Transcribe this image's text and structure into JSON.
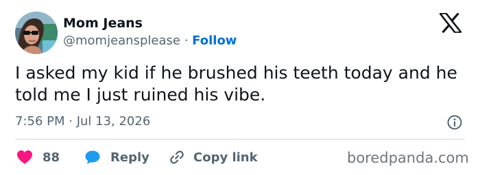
{
  "author": {
    "display_name": "Mom Jeans",
    "handle": "@momjeansplease",
    "separator": "·",
    "follow_label": "Follow"
  },
  "tweet": {
    "text": "I asked my kid if he brushed his teeth today and he told me I just ruined his vibe.",
    "timestamp": "7:56 PM · Jul 13, 2026"
  },
  "actions": {
    "likes_count": "88",
    "reply_label": "Reply",
    "copy_link_label": "Copy link"
  },
  "watermark": "boredpanda.com",
  "icons": {
    "platform": "x-logo-icon",
    "info": "info-icon",
    "like": "heart-icon",
    "reply": "speech-bubble-icon",
    "copy": "link-icon"
  },
  "colors": {
    "text": "#0f1419",
    "secondary_text": "#536471",
    "follow_link": "#006fd6",
    "like": "#f91880",
    "reply": "#1d9bf0",
    "divider": "#cfd9de"
  }
}
